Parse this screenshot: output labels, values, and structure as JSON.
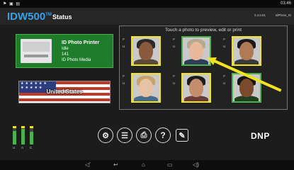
{
  "statusbar": {
    "icons": "⚑ ▣ ▤",
    "time": "03:46"
  },
  "header": {
    "brand": "IDW500",
    "brand_tm": "TM",
    "title": "Status",
    "version": "3.3.0.51",
    "device_id": "IdPhoto_IS"
  },
  "printer": {
    "name": "ID Photo Printer",
    "status": "Idle",
    "count": "141",
    "media": "ID Photo Media"
  },
  "region": {
    "label": "United States",
    "flag_icon": "us-flag"
  },
  "gallery": {
    "hint": "Touch a photo to preview, edit or print",
    "photos": [
      {
        "tags": [
          "P",
          "U"
        ],
        "selected": false,
        "skin": "#8b5a3c",
        "hair": "#2b2b2b",
        "shirt": "#5a4a3a"
      },
      {
        "tags": [
          "P",
          "U"
        ],
        "selected": true,
        "skin": "#e8b89a",
        "hair": "#b8a890",
        "shirt": "#2c3e5a"
      },
      {
        "tags": [
          "P",
          "U"
        ],
        "selected": false,
        "skin": "#b07a56",
        "hair": "#1a1a1a",
        "shirt": "#3a3a3a"
      },
      {
        "tags": [
          "P",
          "U"
        ],
        "selected": false,
        "skin": "#e6c2a6",
        "hair": "#c8a26a",
        "shirt": "#4a6a8a"
      },
      {
        "tags": [
          "P",
          "U"
        ],
        "selected": false,
        "skin": "#c48e6a",
        "hair": "#1c1c1c",
        "shirt": "#6a3a3a"
      },
      {
        "tags": [
          "P",
          "U"
        ],
        "selected": true,
        "skin": "#7a4a2e",
        "hair": "#151515",
        "shirt": "#1f3f1f"
      }
    ]
  },
  "levels": {
    "items": [
      {
        "label": "U",
        "fill": 0.75
      },
      {
        "label": "A",
        "fill": 0.85
      },
      {
        "label": "C",
        "fill": 0.7
      }
    ]
  },
  "toolbar": {
    "items": [
      {
        "name": "settings",
        "icon": "gear-icon",
        "glyph": "⚙"
      },
      {
        "name": "adjust",
        "icon": "sliders-icon",
        "glyph": "☰"
      },
      {
        "name": "print",
        "icon": "printer-icon",
        "glyph": "⎙"
      },
      {
        "name": "help",
        "icon": "help-icon",
        "glyph": "?"
      },
      {
        "name": "edit",
        "icon": "edit-icon",
        "glyph": "✎"
      }
    ]
  },
  "brand_logo": "DNP",
  "navbar": {
    "items": [
      {
        "name": "volume-down",
        "glyph": "◁ʼ"
      },
      {
        "name": "back",
        "glyph": "↩"
      },
      {
        "name": "home",
        "glyph": "⌂"
      },
      {
        "name": "recents",
        "glyph": "▭"
      },
      {
        "name": "volume-up",
        "glyph": "◁)"
      }
    ]
  },
  "colors": {
    "accent": "#3aa0e6",
    "active": "#1f7c2a",
    "highlight": "#f1e31e"
  }
}
